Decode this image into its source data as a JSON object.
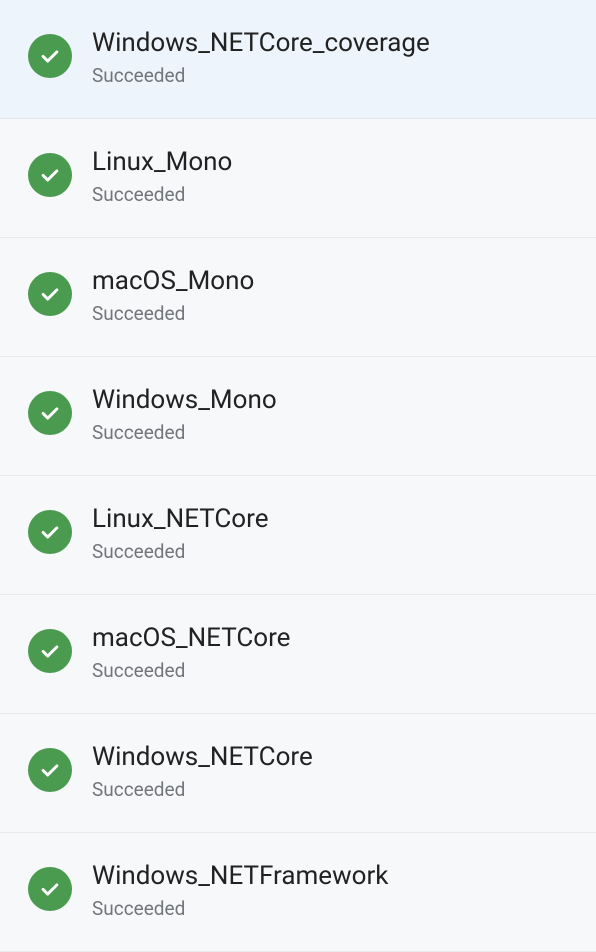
{
  "jobs": [
    {
      "name": "Windows_NETCore_coverage",
      "status": "Succeeded",
      "selected": true
    },
    {
      "name": "Linux_Mono",
      "status": "Succeeded",
      "selected": false
    },
    {
      "name": "macOS_Mono",
      "status": "Succeeded",
      "selected": false
    },
    {
      "name": "Windows_Mono",
      "status": "Succeeded",
      "selected": false
    },
    {
      "name": "Linux_NETCore",
      "status": "Succeeded",
      "selected": false
    },
    {
      "name": "macOS_NETCore",
      "status": "Succeeded",
      "selected": false
    },
    {
      "name": "Windows_NETCore",
      "status": "Succeeded",
      "selected": false
    },
    {
      "name": "Windows_NETFramework",
      "status": "Succeeded",
      "selected": false
    }
  ],
  "icons": {
    "success": "checkmark-icon"
  },
  "colors": {
    "success_bg": "#4a9b4f",
    "success_fg": "#ffffff",
    "page_bg": "#f7f8fa",
    "selected_bg": "#edf4fb"
  }
}
